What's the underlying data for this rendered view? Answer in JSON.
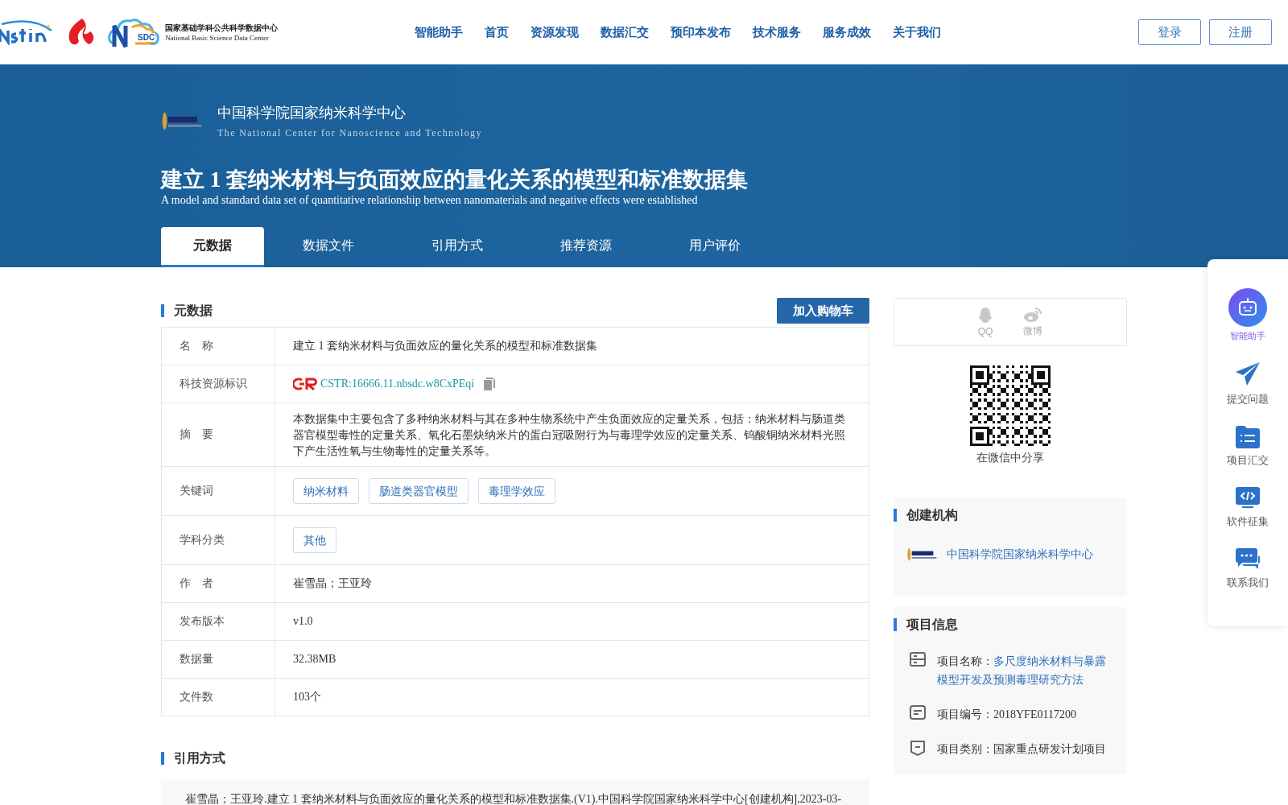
{
  "header": {
    "nav": [
      {
        "label": "智能助手"
      },
      {
        "label": "首页"
      },
      {
        "label": "资源发现"
      },
      {
        "label": "数据汇交"
      },
      {
        "label": "预印本发布"
      },
      {
        "label": "技术服务"
      },
      {
        "label": "服务成效"
      },
      {
        "label": "关于我们"
      }
    ],
    "auth_buttons": [
      "登录",
      "注册"
    ],
    "logo_text": {
      "name": "国家基础学科公共科学数据中心",
      "name_en": "National Basic Science Data Center",
      "mark": "SDC"
    }
  },
  "banner": {
    "org_name": "中国科学院国家纳米科学中心",
    "org_name_en": "The National Center for Nanoscience and Technology",
    "title": "建立 1 套纳米材料与负面效应的量化关系的模型和标准数据集",
    "subtitle": "A model and standard data set of quantitative relationship between nanomaterials and negative effects were established",
    "tabs": [
      {
        "label": "元数据",
        "selected": true
      },
      {
        "label": "数据文件",
        "selected": false
      },
      {
        "label": "引用方式",
        "selected": false
      },
      {
        "label": "推荐资源",
        "selected": false
      },
      {
        "label": "用户评价",
        "selected": false
      }
    ]
  },
  "metadata": {
    "heading": "元数据",
    "cart_button": "加入购物车",
    "rows": [
      {
        "kind": "text",
        "label": "名　称",
        "value": "建立 1 套纳米材料与负面效应的量化关系的模型和标准数据集"
      },
      {
        "kind": "cstr",
        "label": "科技资源标识",
        "value": "CSTR:16666.11.nbsdc.w8CxPEqi"
      },
      {
        "kind": "text",
        "label": "摘　要",
        "value": "本数据集中主要包含了多种纳米材料与其在多种生物系统中产生负面效应的定量关系，包括：纳米材料与肠道类器官模型毒性的定量关系、氧化石墨炔纳米片的蛋白冠吸附行为与毒理学效应的定量关系、钨酸铜纳米材料光照下产生活性氧与生物毒性的定量关系等。"
      },
      {
        "kind": "tags",
        "label": "关键词",
        "tags": [
          "纳米材料",
          "肠道类器官模型",
          "毒理学效应"
        ]
      },
      {
        "kind": "tags",
        "label": "学科分类",
        "tags": [
          "其他"
        ]
      },
      {
        "kind": "text",
        "label": "作　者",
        "value": "崔雪晶；王亚玲"
      },
      {
        "kind": "text",
        "label": "发布版本",
        "value": "v1.0"
      },
      {
        "kind": "text",
        "label": "数据量",
        "value": "32.38MB"
      },
      {
        "kind": "text",
        "label": "文件数",
        "value": "103个"
      }
    ]
  },
  "citation": {
    "heading": "引用方式",
    "text": "崔雪晶；王亚玲.建立 1 套纳米材料与负面效应的量化关系的模型和标准数据集.(V1).中国科学院国家纳米科学中心[创建机构],2023-03-"
  },
  "share": {
    "items": [
      {
        "kind": "qq",
        "label": "QQ"
      },
      {
        "kind": "weibo",
        "label": "微博"
      }
    ],
    "qr_caption": "在微信中分享"
  },
  "creator": {
    "heading": "创建机构",
    "name": "中国科学院国家纳米科学中心"
  },
  "project": {
    "heading": "项目信息",
    "items": [
      {
        "kind": "name",
        "label": "项目名称：",
        "value": "多尺度纳米材料与暴露模型开发及预测毒理研究方法",
        "link": true
      },
      {
        "kind": "number",
        "label": "项目编号：",
        "value": "2018YFE0117200",
        "link": false
      },
      {
        "kind": "category",
        "label": "项目类别：",
        "value": "国家重点研发计划项目",
        "link": false
      }
    ]
  },
  "float_sidebar": {
    "items": [
      {
        "kind": "robot",
        "label": "智能助手",
        "selected": true
      },
      {
        "kind": "send",
        "label": "提交问题",
        "selected": false
      },
      {
        "kind": "folder",
        "label": "项目汇交",
        "selected": false
      },
      {
        "kind": "code",
        "label": "软件征集",
        "selected": false
      },
      {
        "kind": "chat",
        "label": "联系我们",
        "selected": false
      }
    ]
  }
}
